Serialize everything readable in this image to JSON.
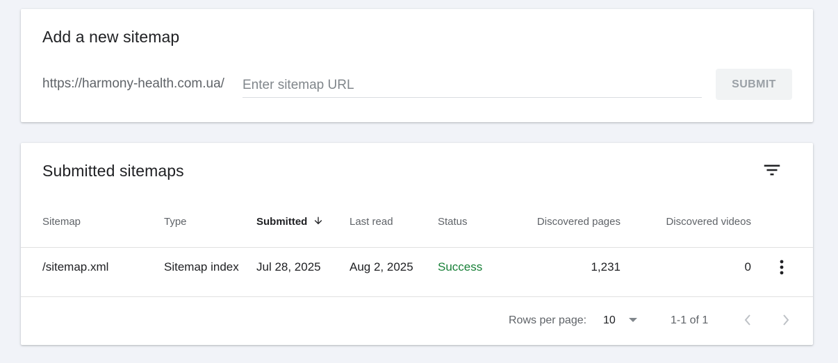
{
  "add_sitemap": {
    "title": "Add a new sitemap",
    "url_prefix": "https://harmony-health.com.ua/",
    "input_value": "",
    "input_placeholder": "Enter sitemap URL",
    "submit_label": "SUBMIT"
  },
  "submitted": {
    "title": "Submitted sitemaps",
    "filter_icon": "filter-list-icon",
    "columns": [
      {
        "label": "Sitemap"
      },
      {
        "label": "Type"
      },
      {
        "label": "Submitted",
        "sorted": "descending"
      },
      {
        "label": "Last read"
      },
      {
        "label": "Status"
      },
      {
        "label": "Discovered pages"
      },
      {
        "label": "Discovered videos"
      }
    ],
    "rows": [
      {
        "sitemap": "/sitemap.xml",
        "type": "Sitemap index",
        "submitted": "Jul 28, 2025",
        "last_read": "Aug 2, 2025",
        "status": "Success",
        "discovered_pages": "1,231",
        "discovered_videos": "0",
        "menu_icon": "more-vert-icon"
      }
    ],
    "pagination": {
      "rows_per_page_label": "Rows per page:",
      "rows_per_page_value": "10",
      "range_text": "1-1 of 1"
    }
  },
  "colors": {
    "background": "#f1f3f8",
    "status_success": "#188038",
    "submit_disabled_bg": "#f1f3f4",
    "submit_disabled_text": "#9aa0a6"
  }
}
